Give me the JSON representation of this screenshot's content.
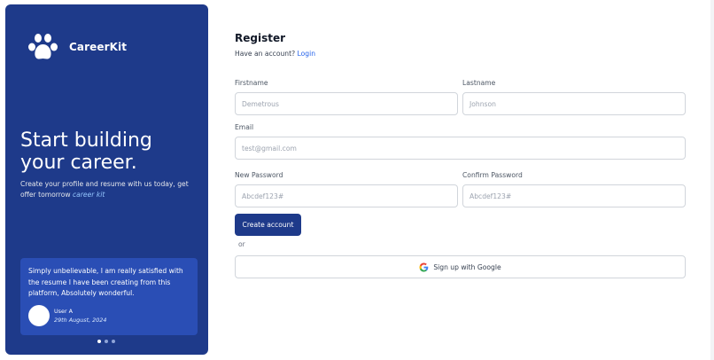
{
  "brand": {
    "name": "CareerKit"
  },
  "hero": {
    "headline": "Start building your career.",
    "subtext": "Create your profile and resume with us today, get offer tomorrow",
    "accent": "career kit"
  },
  "testimonial": {
    "quote": "Simply unbelievable, I am really satisfied with the resume I have been creating from this platform, Absolutely wonderful.",
    "author": "User A",
    "date": "29th August, 2024"
  },
  "carousel": {
    "slides": 3,
    "active": 1
  },
  "form": {
    "title": "Register",
    "have_account": "Have an account?",
    "login_link": "Login",
    "firstname": {
      "label": "Firstname",
      "placeholder": "Demetrous"
    },
    "lastname": {
      "label": "Lastname",
      "placeholder": "Johnson"
    },
    "email": {
      "label": "Email",
      "placeholder": "test@gmail.com"
    },
    "new_password": {
      "label": "New Password",
      "placeholder": "Abcdef123#"
    },
    "confirm_password": {
      "label": "Confirm Password",
      "placeholder": "Abcdef123#"
    },
    "create_account": "Create account",
    "or": "or",
    "google": "Sign up with Google"
  },
  "colors": {
    "brand": "#1e3a8a",
    "card": "#2a4eb5",
    "link": "#2563eb"
  },
  "icons": {
    "brand": "paw-icon",
    "google": "google-icon"
  }
}
